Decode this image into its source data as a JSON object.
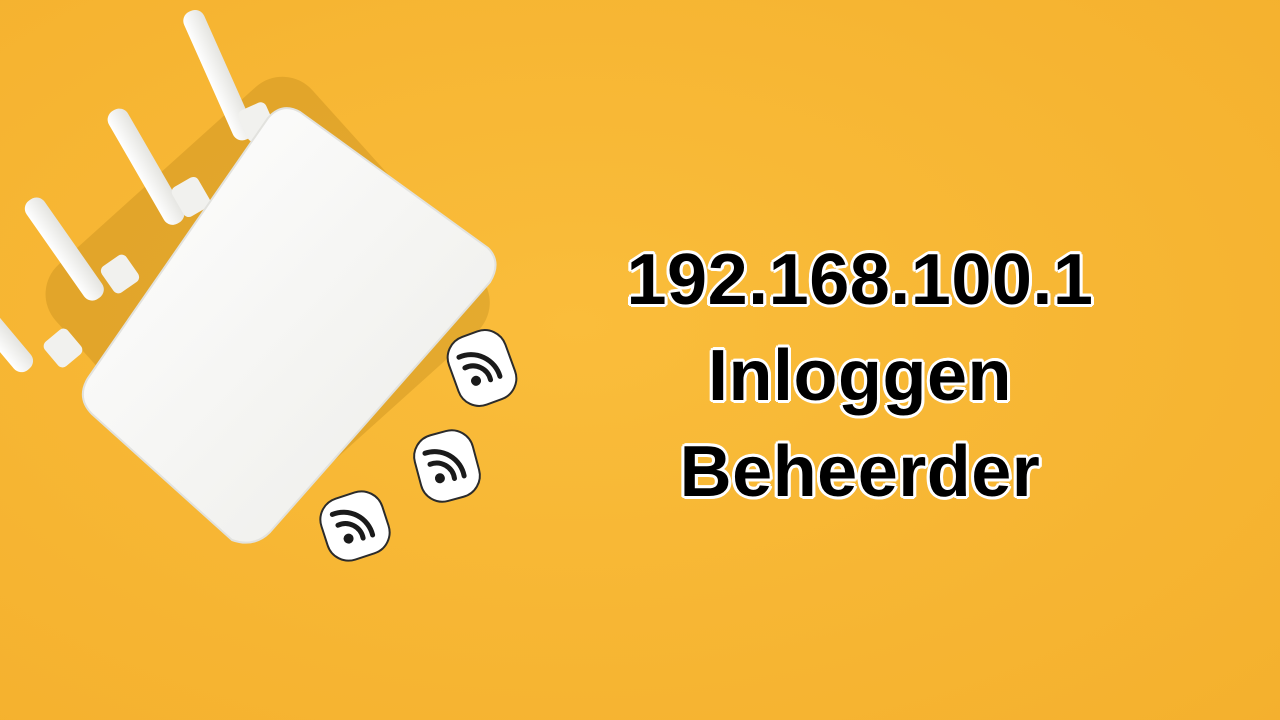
{
  "title_lines": {
    "line1": "192.168.100.1",
    "line2": "Inloggen",
    "line3": "Beheerder"
  },
  "colors": {
    "background": "#F8B733",
    "router": "#F5F5F3",
    "text": "#000000",
    "text_outline": "#FFFFFF"
  },
  "objects": {
    "router": "wireless-router-with-four-antennas",
    "wifi_tokens": [
      "wifi-icon",
      "wifi-icon",
      "wifi-icon"
    ]
  }
}
